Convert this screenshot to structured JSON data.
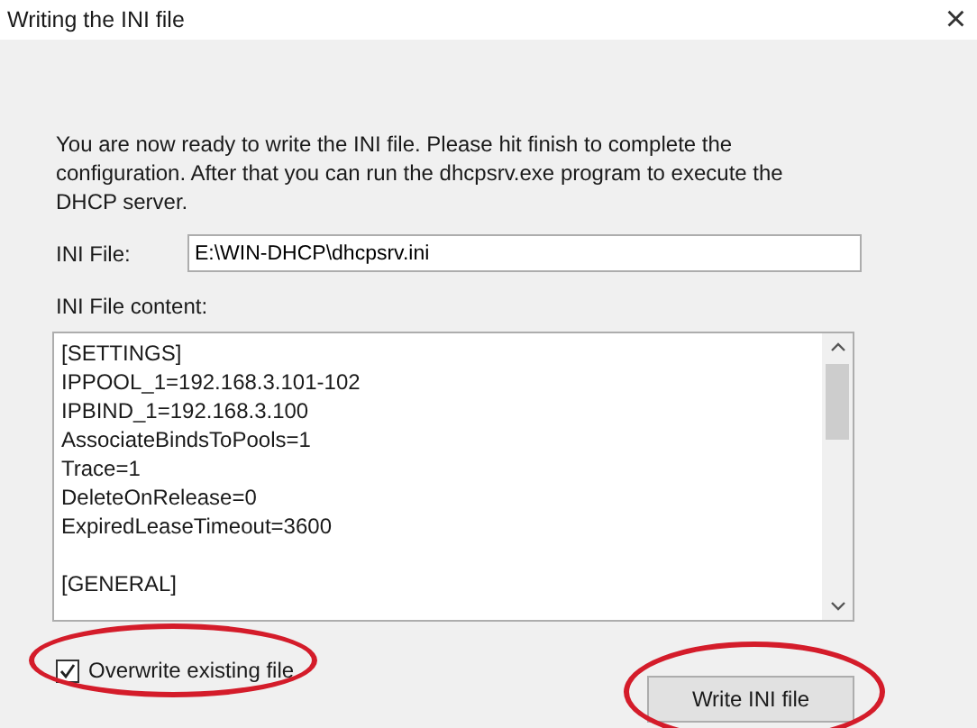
{
  "window": {
    "title": "Writing the INI file",
    "close": "×"
  },
  "intro": "You are now ready to write the INI file. Please hit finish to complete the configuration. After that you can run the dhcpsrv.exe program to execute the DHCP server.",
  "ini_file": {
    "label": "INI File:",
    "value": "E:\\WIN-DHCP\\dhcpsrv.ini"
  },
  "content": {
    "label": "INI File content:",
    "sections": [
      {
        "lines": [
          "[SETTINGS]",
          "IPPOOL_1=192.168.3.101-102",
          "IPBIND_1=192.168.3.100",
          "AssociateBindsToPools=1",
          "Trace=1",
          "DeleteOnRelease=0",
          "ExpiredLeaseTimeout=3600"
        ]
      },
      {
        "lines": [
          "[GENERAL]"
        ]
      }
    ]
  },
  "overwrite": {
    "label": "Overwrite existing file",
    "checked": true
  },
  "buttons": [
    "Write INI file"
  ]
}
